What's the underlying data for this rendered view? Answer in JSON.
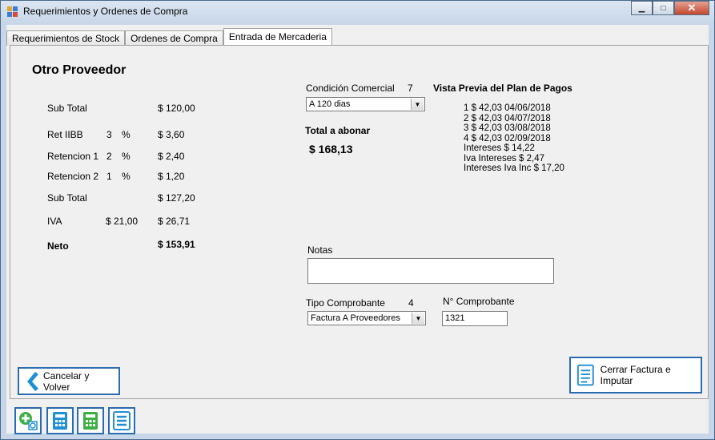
{
  "window": {
    "title": "Requerimientos y Ordenes de Compra",
    "minimize_glyph": "▁",
    "maximize_glyph": "□",
    "close_glyph": "✕"
  },
  "tabs": [
    {
      "label": "Requerimientos de Stock",
      "active": false
    },
    {
      "label": "Ordenes de Compra",
      "active": false
    },
    {
      "label": "Entrada de Mercaderia",
      "active": true
    }
  ],
  "supplier": {
    "name": "Otro Proveedor"
  },
  "totals": {
    "subtotal_label": "Sub Total",
    "subtotal_value": "$ 120,00",
    "ret_iibb_label": "Ret IIBB",
    "ret_iibb_pct": "3",
    "ret_iibb_pct_sign": "%",
    "ret_iibb_value": "$ 3,60",
    "retencion1_label": "Retencion 1",
    "retencion1_pct": "2",
    "retencion1_pct_sign": "%",
    "retencion1_value": "$ 2,40",
    "retencion2_label": "Retencion 2",
    "retencion2_pct": "1",
    "retencion2_pct_sign": "%",
    "retencion2_value": "$ 1,20",
    "subtotal2_label": "Sub Total",
    "subtotal2_value": "$ 127,20",
    "iva_label": "IVA",
    "iva_rate": "$ 21,00",
    "iva_value": "$ 26,71",
    "neto_label": "Neto",
    "neto_value": "$ 153,91"
  },
  "commercial": {
    "condition_label": "Condición Comercial",
    "condition_code": "7",
    "condition_value": "A 120 dias",
    "total_label": "Total a abonar",
    "total_value": "$ 168,13"
  },
  "payment_plan": {
    "title": "Vista Previa del Plan de Pagos",
    "lines": [
      "1  $ 42,03  04/06/2018",
      "2  $ 42,03  04/07/2018",
      "3  $ 42,03  03/08/2018",
      "4  $ 42,03  02/09/2018"
    ],
    "interest": "Intereses  $ 14,22",
    "iva_interest": "Iva Intereses  $ 2,47",
    "interest_iva_inc": "Intereses Iva Inc  $ 17,20"
  },
  "notes": {
    "label": "Notas",
    "value": ""
  },
  "voucher": {
    "type_label": "Tipo Comprobante",
    "type_code": "4",
    "type_value": "Factura A Proveedores",
    "number_label": "N° Comprobante",
    "number_value": "1321"
  },
  "actions": {
    "cancel_label": "Cancelar y Volver",
    "close_invoice_label": "Cerrar Factura e Imputar"
  },
  "colors": {
    "accent": "#2a6bb1",
    "icon_green": "#3cb043",
    "icon_blue": "#1f8fd6"
  }
}
